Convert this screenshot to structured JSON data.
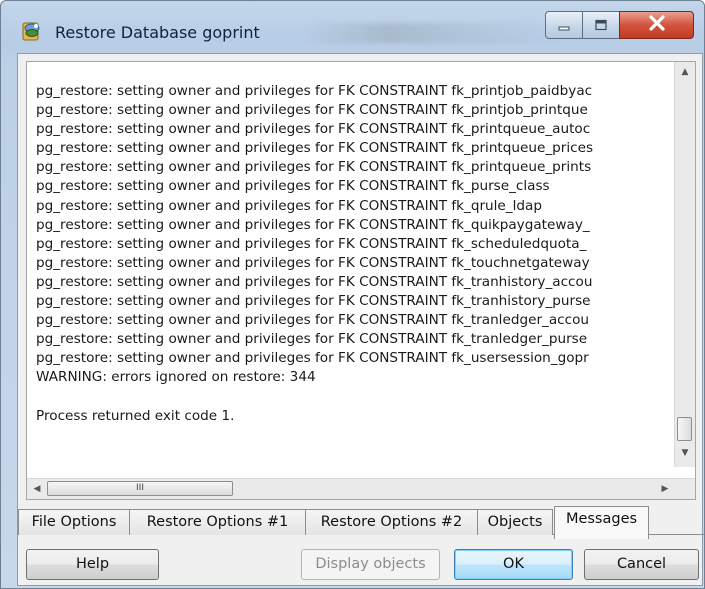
{
  "window": {
    "title": "Restore Database goprint"
  },
  "log": {
    "lines": [
      "pg_restore: setting owner and privileges for FK CONSTRAINT fk_printjob_paidbyac",
      "pg_restore: setting owner and privileges for FK CONSTRAINT fk_printjob_printque",
      "pg_restore: setting owner and privileges for FK CONSTRAINT fk_printqueue_autoc",
      "pg_restore: setting owner and privileges for FK CONSTRAINT fk_printqueue_prices",
      "pg_restore: setting owner and privileges for FK CONSTRAINT fk_printqueue_prints",
      "pg_restore: setting owner and privileges for FK CONSTRAINT fk_purse_class",
      "pg_restore: setting owner and privileges for FK CONSTRAINT fk_qrule_ldap",
      "pg_restore: setting owner and privileges for FK CONSTRAINT fk_quikpaygateway_",
      "pg_restore: setting owner and privileges for FK CONSTRAINT fk_scheduledquota_",
      "pg_restore: setting owner and privileges for FK CONSTRAINT fk_touchnetgateway",
      "pg_restore: setting owner and privileges for FK CONSTRAINT fk_tranhistory_accou",
      "pg_restore: setting owner and privileges for FK CONSTRAINT fk_tranhistory_purse",
      "pg_restore: setting owner and privileges for FK CONSTRAINT fk_tranledger_accou",
      "pg_restore: setting owner and privileges for FK CONSTRAINT fk_tranledger_purse",
      "pg_restore: setting owner and privileges for FK CONSTRAINT fk_usersession_gopr",
      "WARNING: errors ignored on restore: 344",
      "",
      "Process returned exit code 1."
    ]
  },
  "scrollbar": {
    "h_thumb_grip": "III"
  },
  "tabs": [
    {
      "label": "File Options"
    },
    {
      "label": "Restore Options #1"
    },
    {
      "label": "Restore Options #2"
    },
    {
      "label": "Objects"
    },
    {
      "label": "Messages",
      "active": true
    }
  ],
  "buttons": {
    "help": "Help",
    "display_objects": "Display objects",
    "ok": "OK",
    "cancel": "Cancel"
  },
  "colors": {
    "title_bar": "#bcd0e6",
    "close_button": "#d2543e",
    "default_button": "#bee6fd"
  }
}
